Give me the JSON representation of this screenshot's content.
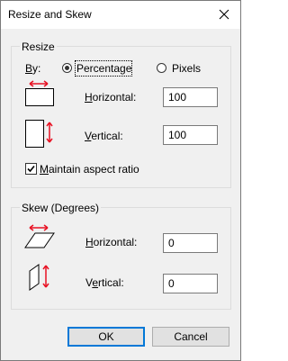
{
  "window": {
    "title": "Resize and Skew"
  },
  "resize": {
    "group_label": "Resize",
    "by_label": "By:",
    "percentage_label": "Percentage",
    "pixels_label": "Pixels",
    "selected": "Percentage",
    "horizontal_label": "Horizontal:",
    "horizontal_value": "100",
    "vertical_label": "Vertical:",
    "vertical_value": "100",
    "maintain_label": "Maintain aspect ratio",
    "maintain_checked": true
  },
  "skew": {
    "group_label": "Skew (Degrees)",
    "horizontal_label": "Horizontal:",
    "horizontal_value": "0",
    "vertical_label": "Vertical:",
    "vertical_value": "0"
  },
  "buttons": {
    "ok": "OK",
    "cancel": "Cancel"
  },
  "colors": {
    "accent": "#0078d7",
    "arrow": "#e81123"
  }
}
